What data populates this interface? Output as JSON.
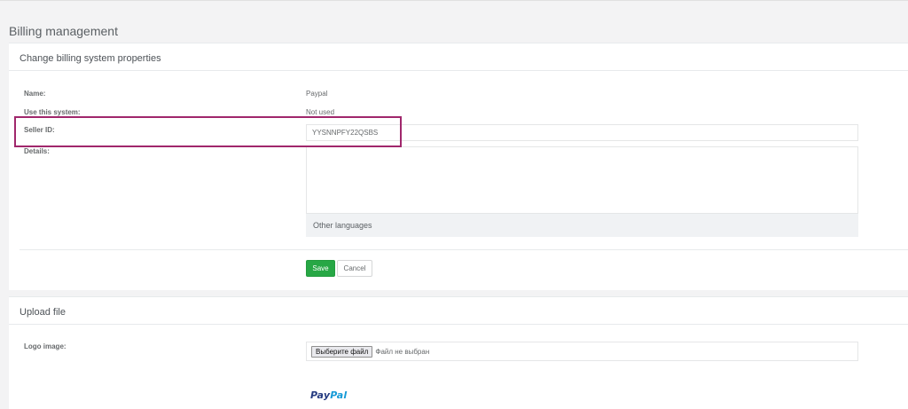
{
  "page": {
    "title": "Billing management"
  },
  "billing_panel": {
    "heading": "Change billing system properties",
    "fields": {
      "name_label": "Name:",
      "name_value": "Paypal",
      "use_label": "Use this system:",
      "use_value": "Not used",
      "seller_label": "Seller ID:",
      "seller_value": "YYSNNPFY22QSBS",
      "details_label": "Details:",
      "details_value": ""
    },
    "other_languages_label": "Other languages",
    "save_label": "Save",
    "cancel_label": "Cancel",
    "highlight_color": "#a0276c",
    "save_color": "#27a745"
  },
  "upload_panel": {
    "heading": "Upload file",
    "logo_label": "Logo image:",
    "choose_file_label": "Выберите файл",
    "no_file_text": "Файл не выбран",
    "logo": {
      "part1": "Pay",
      "part2": "Pal"
    }
  }
}
